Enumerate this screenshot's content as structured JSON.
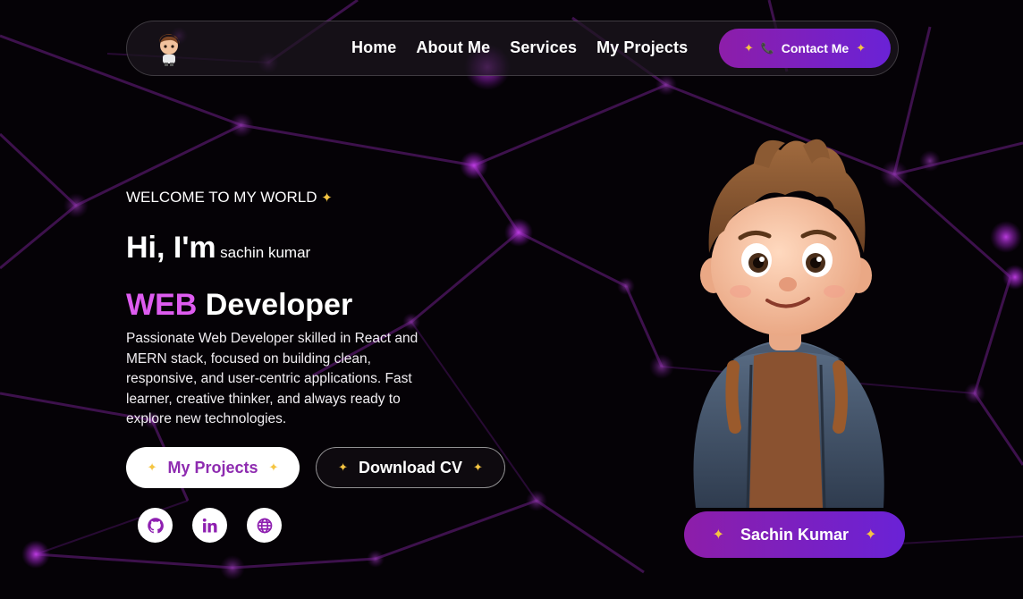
{
  "nav": {
    "links": [
      "Home",
      "About Me",
      "Services",
      "My Projects"
    ],
    "contact_label": "Contact Me"
  },
  "hero": {
    "welcome": "WELCOME TO MY WORLD",
    "greeting": "Hi, I'm",
    "name": "sachin kumar",
    "role_accent": "WEB",
    "role_rest": "Developer",
    "description": "Passionate Web Developer skilled in React and MERN stack, focused on building clean, responsive, and user-centric applications. Fast learner, creative thinker, and always ready to explore new technologies.",
    "primary_button": "My Projects",
    "secondary_button": "Download CV",
    "socials": [
      "github-icon",
      "linkedin-icon",
      "globe-icon"
    ]
  },
  "badge": {
    "name": "Sachin Kumar"
  },
  "colors": {
    "accent": "#de5cf0",
    "button_gradient_start": "#8d1ea9",
    "button_gradient_end": "#6a22d6",
    "sparkle": "#f5c542",
    "background": "#050206"
  }
}
